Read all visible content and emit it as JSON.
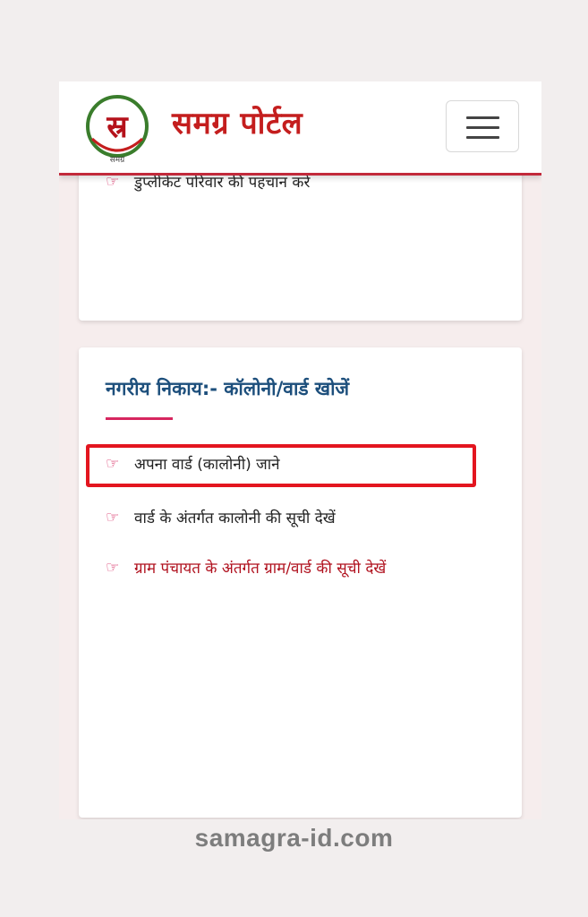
{
  "header": {
    "brand": "समग्र पोर्टल",
    "logo_letter": "स्र",
    "logo_caption": "समग्र",
    "menu_icon": "hamburger-icon"
  },
  "cards": {
    "top_item": "डुप्लीकेट परिवार की पहचान करें",
    "section_title": "नगरीय निकाय:- कॉलोनी/वार्ड खोजें",
    "items": [
      {
        "label": "अपना वार्ड (कालोनी) जाने",
        "icon": "pointing-hand-icon"
      },
      {
        "label": "वार्ड के अंतर्गत कालोनी की सूची देखें",
        "icon": "pointing-hand-icon"
      },
      {
        "label": "ग्राम पंचायत के अंतर्गत ग्राम/वार्ड की सूची देखें",
        "icon": "pointing-hand-icon"
      }
    ]
  },
  "watermark": "samagra-id.com",
  "colors": {
    "brand_red": "#c41e1e",
    "title_blue": "#1d4f7c",
    "accent_pink": "#d7265f",
    "highlight_red": "#e3151f"
  }
}
